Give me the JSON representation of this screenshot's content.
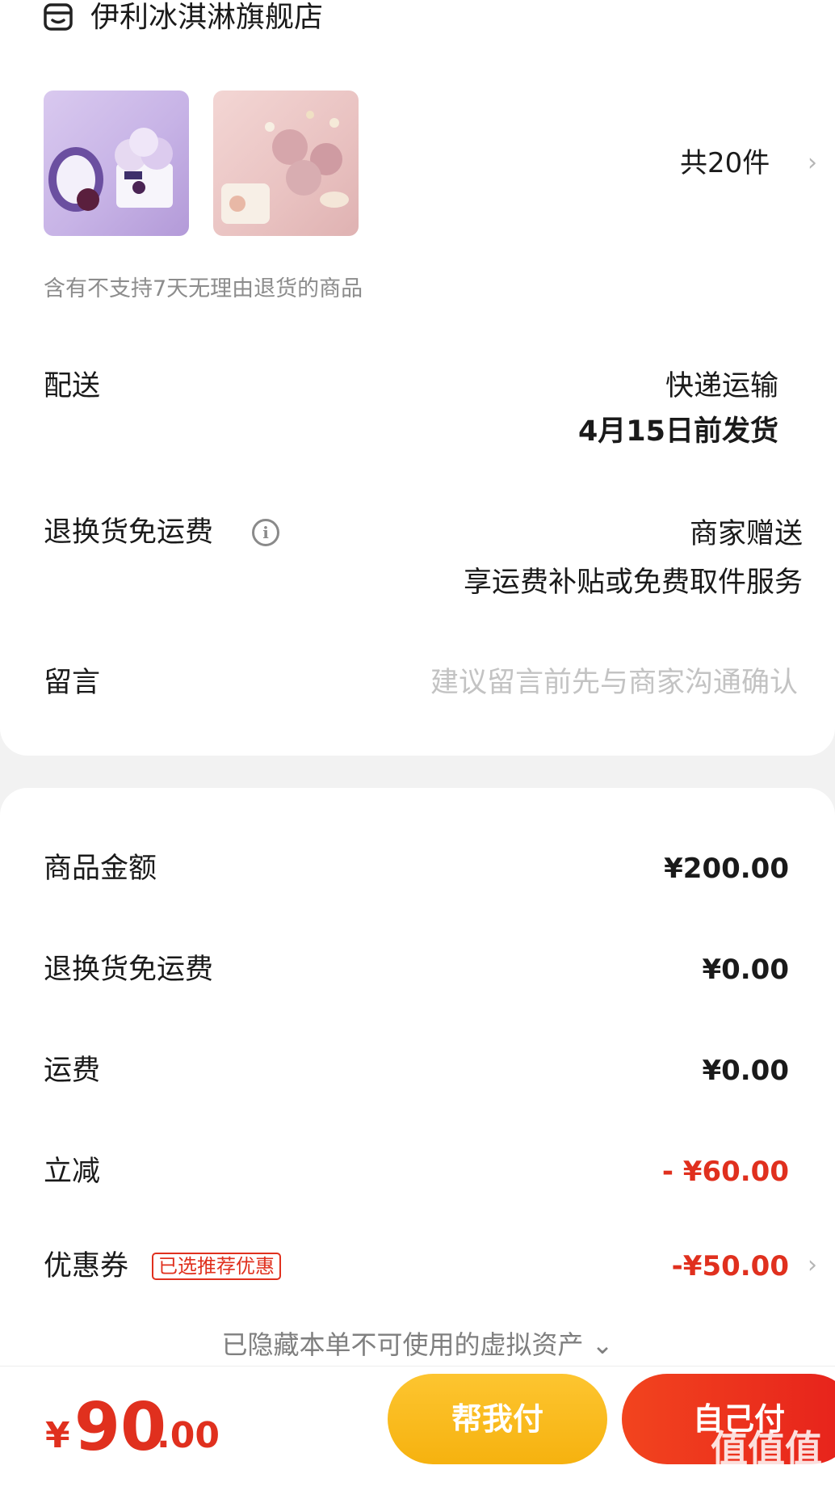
{
  "store": {
    "name": "伊利冰淇淋旗舰店",
    "icon": "store-icon"
  },
  "products": {
    "count_label": "共20件",
    "chevron": "›",
    "return_notice": "含有不支持7天无理由退货的商品",
    "thumbs": [
      {
        "name": "product-thumb-1",
        "colors": [
          "#d9c9ef",
          "#b39ad8"
        ]
      },
      {
        "name": "product-thumb-2",
        "colors": [
          "#f3d6d4",
          "#dfb2b2"
        ]
      }
    ]
  },
  "delivery": {
    "label": "配送",
    "method": "快递运输",
    "ship_by": "4月15日前发货"
  },
  "return_shipping": {
    "label": "退换货免运费",
    "line1": "商家赠送",
    "line2": "享运费补贴或免费取件服务"
  },
  "message": {
    "label": "留言",
    "placeholder": "建议留言前先与商家沟通确认"
  },
  "price_details": {
    "goods_label": "商品金额",
    "goods_amount": "¥200.00",
    "return_fee_label": "退换货免运费",
    "return_fee_amount": "¥0.00",
    "shipping_label": "运费",
    "shipping_amount": "¥0.00",
    "instant_discount_label": "立减",
    "instant_discount_amount": "- ¥60.00",
    "coupon_label": "优惠券",
    "coupon_badge": "已选推荐优惠",
    "coupon_amount": "-¥50.00",
    "coupon_chevron": "›"
  },
  "hidden_assets_note": "已隐藏本单不可使用的虚拟资产 ⌄",
  "footer": {
    "currency": "¥",
    "total_int": "90",
    "total_dec": ".00",
    "help_pay_label": "帮我付",
    "self_pay_label": "自己付",
    "watermark": "值值值",
    "watermark_url": "zhizhizhi.com"
  },
  "colors": {
    "accent_red": "#e0301e",
    "accent_yellow": "#f6b20f",
    "background": "#f2f2f2"
  }
}
